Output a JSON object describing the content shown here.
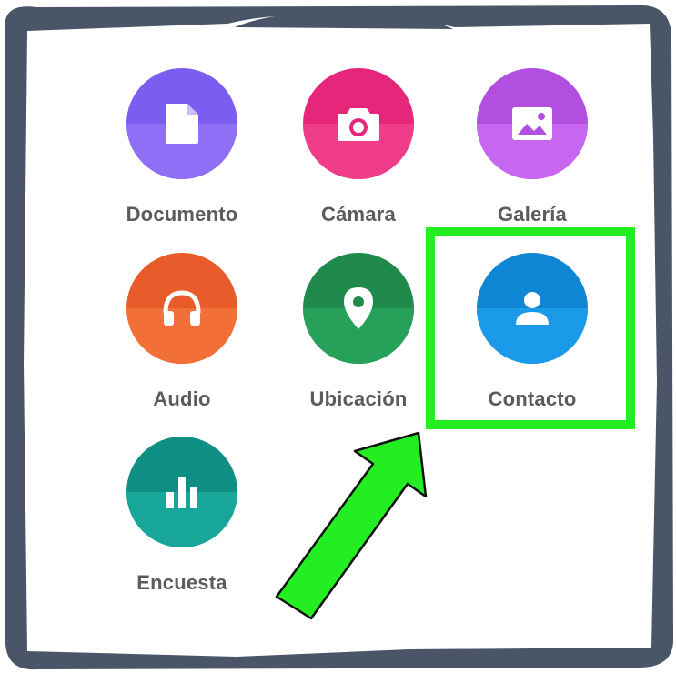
{
  "attach_menu": {
    "items": [
      {
        "label": "Documento",
        "icon": "document-icon",
        "color_top": "#7b5ef0",
        "color_bottom": "#8e6ff5"
      },
      {
        "label": "Cámara",
        "icon": "camera-icon",
        "color_top": "#e5267a",
        "color_bottom": "#ef3d8a"
      },
      {
        "label": "Galería",
        "icon": "gallery-icon",
        "color_top": "#b24ee0",
        "color_bottom": "#c766f0"
      },
      {
        "label": "Audio",
        "icon": "headphones-icon",
        "color_top": "#e85b2a",
        "color_bottom": "#f27038"
      },
      {
        "label": "Ubicación",
        "icon": "location-pin-icon",
        "color_top": "#1f8a4c",
        "color_bottom": "#27a15a"
      },
      {
        "label": "Contacto",
        "icon": "contact-person-icon",
        "color_top": "#0e86d4",
        "color_bottom": "#1a9ae8"
      },
      {
        "label": "Encuesta",
        "icon": "poll-chart-icon",
        "color_top": "#0f8f84",
        "color_bottom": "#17a699"
      }
    ]
  },
  "annotation": {
    "highlight_color": "#22ee22",
    "arrow_color": "#22ee22",
    "highlighted_item": "Contacto"
  },
  "frame": {
    "border_color": "#4a5568"
  }
}
